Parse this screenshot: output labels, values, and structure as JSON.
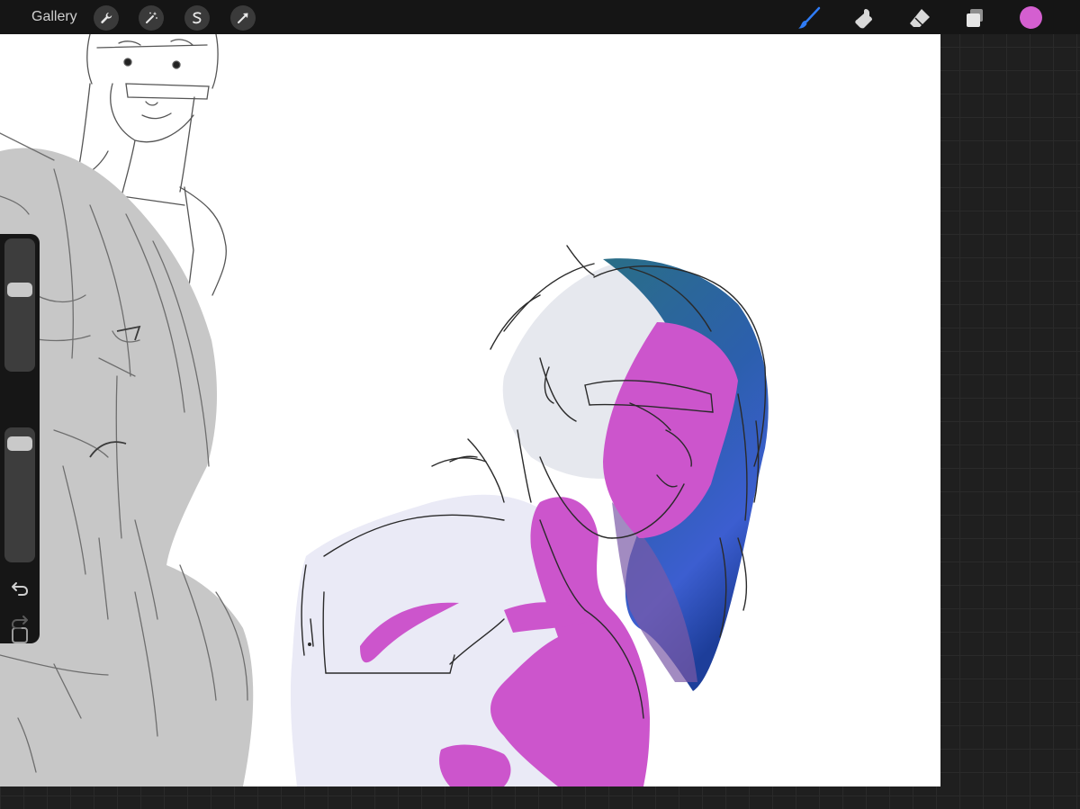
{
  "topbar": {
    "gallery_label": "Gallery",
    "left_tools": [
      "wrench-icon",
      "magic-wand-icon",
      "selection-icon",
      "transform-arrow-icon"
    ],
    "right_tools": [
      "brush-icon",
      "smudge-icon",
      "eraser-icon",
      "layers-icon"
    ],
    "active_tool": "brush-icon",
    "active_tool_color": "#2f7cf6",
    "current_color": "#d45fd0"
  },
  "sidebar": {
    "brush_size_level": 0.36,
    "opacity_level": 0.04,
    "icons": [
      "modify-square-icon",
      "undo-icon",
      "redo-icon"
    ]
  },
  "canvas": {
    "background": "#ffffff",
    "palette": [
      "#c7c7c7",
      "#eaeaf6",
      "#cc55cc",
      "#2a6e86",
      "#3c5ed0"
    ]
  }
}
